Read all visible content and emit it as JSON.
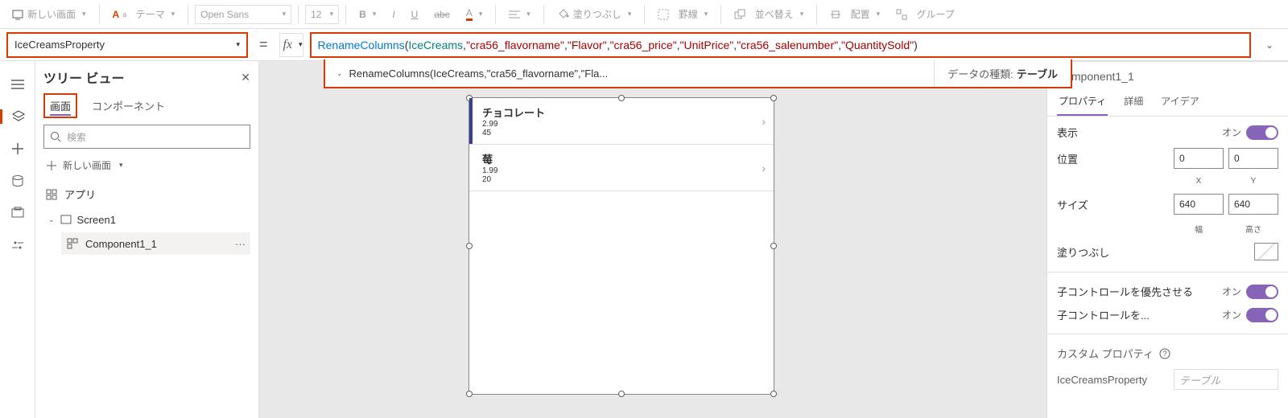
{
  "ribbon": {
    "new_screen": "新しい画面",
    "theme": "テーマ",
    "font": "Open Sans",
    "size": "12",
    "fill": "塗りつぶし",
    "border": "罫線",
    "arrange": "並べ替え",
    "align": "配置",
    "group": "グループ"
  },
  "formula": {
    "property": "IceCreamsProperty",
    "fn": "RenameColumns",
    "ds": "IceCreams",
    "args_text1": "\"cra56_flavorname\"",
    "args_text2": "\"Flavor\"",
    "args_text3": "\"cra56_price\"",
    "args_text4": "\"UnitPrice\"",
    "args_text5": "\"cra56_salenumber\"",
    "args_text6": "\"QuantitySold\"",
    "hint": "RenameColumns(IceCreams,\"cra56_flavorname\",\"Fla...",
    "datatype_label": "データの種類:",
    "datatype_value": "テーブル"
  },
  "tree": {
    "title": "ツリー ビュー",
    "tab_screens": "画面",
    "tab_components": "コンポーネント",
    "search_placeholder": "検索",
    "new_screen": "新しい画面",
    "app": "アプリ",
    "screen": "Screen1",
    "component": "Component1_1"
  },
  "gallery": {
    "items": [
      {
        "title": "チョコレート",
        "price": "2.99",
        "qty": "45"
      },
      {
        "title": "莓",
        "price": "1.99",
        "qty": "20"
      }
    ]
  },
  "right": {
    "name": "Component1_1",
    "tabs": {
      "props": "プロパティ",
      "details": "詳細",
      "ideas": "アイデア"
    },
    "visible": {
      "label": "表示",
      "on": "オン"
    },
    "position": {
      "label": "位置",
      "x": "0",
      "y": "0",
      "xl": "X",
      "yl": "Y"
    },
    "size": {
      "label": "サイズ",
      "w": "640",
      "h": "640",
      "wl": "幅",
      "hl": "高さ"
    },
    "fill": "塗りつぶし",
    "child_priority": {
      "label": "子コントロールを優先させる",
      "on": "オン"
    },
    "child_control": {
      "label": "子コントロールを...",
      "on": "オン"
    },
    "custom": {
      "heading": "カスタム プロパティ",
      "name": "IceCreamsProperty",
      "type": "テーブル"
    }
  }
}
